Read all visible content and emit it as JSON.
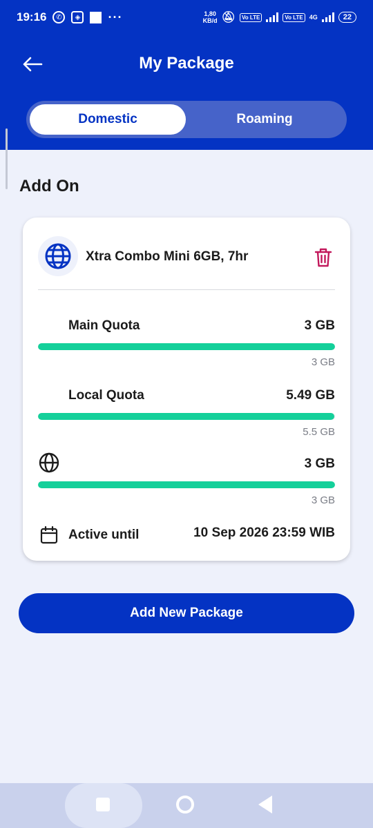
{
  "status_bar": {
    "time": "19:16",
    "speed_value": "1,80",
    "speed_unit": "KB/d",
    "volte1": "Vo LTE",
    "volte2": "Vo LTE",
    "net_type": "4G",
    "battery": "22"
  },
  "header": {
    "title": "My Package",
    "back_icon": "arrow-left-icon",
    "tabs": [
      {
        "label": "Domestic",
        "selected": true
      },
      {
        "label": "Roaming",
        "selected": false
      }
    ]
  },
  "section": {
    "title": "Add On"
  },
  "package": {
    "name": "Xtra Combo Mini 6GB, 7hr",
    "icon": "globe-icon",
    "delete_icon": "trash-icon",
    "quotas": [
      {
        "label": "Main Quota",
        "remaining": "3 GB",
        "total": "3 GB",
        "fraction": 1.0
      },
      {
        "label": "Local Quota",
        "remaining": "5.49 GB",
        "total": "5.5 GB",
        "fraction": 0.998
      },
      {
        "label": "",
        "icon": "globe-icon",
        "remaining": "3 GB",
        "total": "3 GB",
        "fraction": 1.0
      }
    ],
    "active_label": "Active until",
    "active_date": "10 Sep 2026 23:59 WIB"
  },
  "actions": {
    "add_new_package": "Add New Package"
  },
  "colors": {
    "brand": "#0433c3",
    "progress": "#14d09a",
    "trash": "#c2185b",
    "background": "#eef1fb"
  }
}
